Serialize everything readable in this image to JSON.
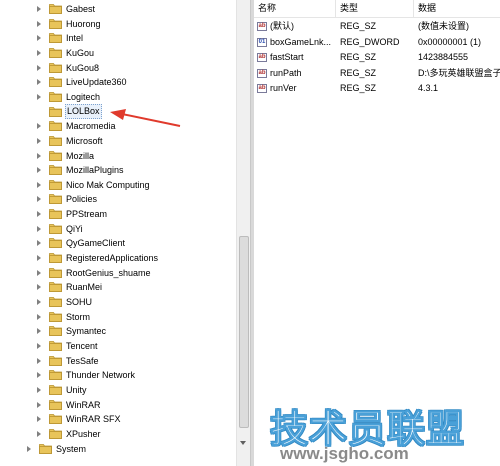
{
  "tree": {
    "items": [
      {
        "label": "Gabest"
      },
      {
        "label": "Huorong"
      },
      {
        "label": "Intel"
      },
      {
        "label": "KuGou"
      },
      {
        "label": "KuGou8"
      },
      {
        "label": "LiveUpdate360"
      },
      {
        "label": "Logitech"
      },
      {
        "label": "LOLBox",
        "selected": true
      },
      {
        "label": "Macromedia"
      },
      {
        "label": "Microsoft"
      },
      {
        "label": "Mozilla"
      },
      {
        "label": "MozillaPlugins"
      },
      {
        "label": "Nico Mak Computing"
      },
      {
        "label": "Policies"
      },
      {
        "label": "PPStream"
      },
      {
        "label": "QiYi"
      },
      {
        "label": "QyGameClient"
      },
      {
        "label": "RegisteredApplications"
      },
      {
        "label": "RootGenius_shuame"
      },
      {
        "label": "RuanMei"
      },
      {
        "label": "SOHU"
      },
      {
        "label": "Storm"
      },
      {
        "label": "Symantec"
      },
      {
        "label": "Tencent"
      },
      {
        "label": "TesSafe"
      },
      {
        "label": "Thunder Network"
      },
      {
        "label": "Unity"
      },
      {
        "label": "WinRAR"
      },
      {
        "label": "WinRAR SFX"
      },
      {
        "label": "XPusher"
      }
    ],
    "root_item": {
      "label": "System"
    }
  },
  "values": {
    "headers": {
      "name": "名称",
      "type": "类型",
      "data": "数据"
    },
    "rows": [
      {
        "name": "(默认)",
        "type": "REG_SZ",
        "data": "(数值未设置)",
        "icon": "string-value-icon"
      },
      {
        "name": "boxGameLnk...",
        "type": "REG_DWORD",
        "data": "0x00000001 (1)",
        "icon": "binary-value-icon"
      },
      {
        "name": "fastStart",
        "type": "REG_SZ",
        "data": "1423884555",
        "icon": "string-value-icon"
      },
      {
        "name": "runPath",
        "type": "REG_SZ",
        "data": "D:\\多玩英雄联盟盒子",
        "icon": "string-value-icon"
      },
      {
        "name": "runVer",
        "type": "REG_SZ",
        "data": "4.3.1",
        "icon": "string-value-icon"
      }
    ]
  },
  "watermark": {
    "title": "技术员联盟",
    "url": "www.jsgho.com"
  },
  "colors": {
    "folder": "#e8c45a",
    "selection_border": "#7da2ce",
    "annotation_arrow": "#e03a2c",
    "watermark_blue": "#2e86c1"
  }
}
